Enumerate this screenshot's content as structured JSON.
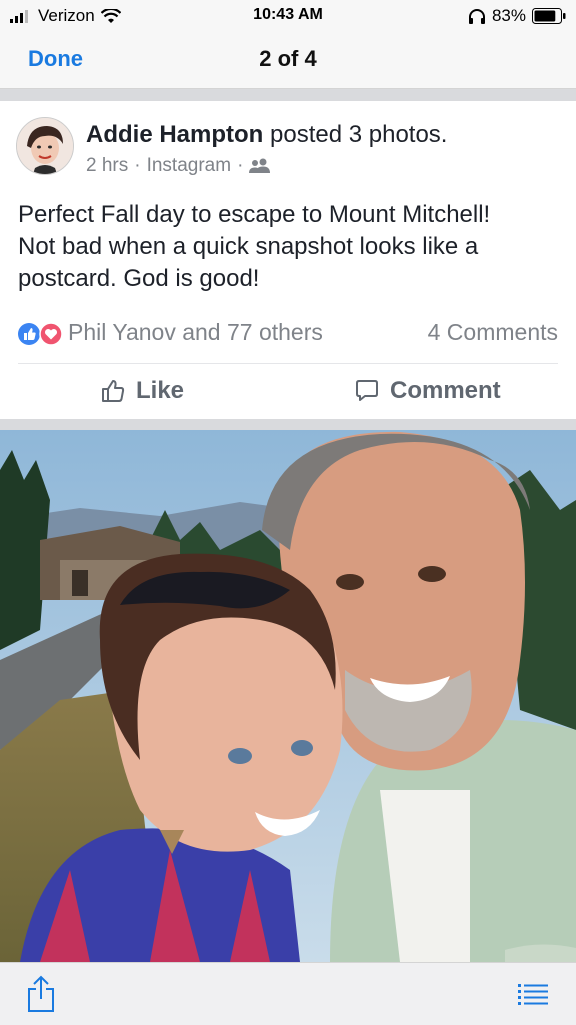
{
  "status_bar": {
    "carrier": "Verizon",
    "time": "10:43 AM",
    "battery": "83%",
    "battery_level": 0.83,
    "icons": [
      "signal-icon",
      "wifi-icon",
      "headphones-icon",
      "battery-icon"
    ]
  },
  "nav": {
    "done_label": "Done",
    "counter": "2 of 4"
  },
  "post": {
    "author": "Addie Hampton",
    "action": "posted 3 photos.",
    "time": "2 hrs",
    "source": "Instagram",
    "separator": "·",
    "audience_icon": "friends-icon",
    "text_lines": [
      "Perfect Fall day to escape to Mount Mitchell!",
      "Not bad when a quick snapshot looks like a",
      "postcard. God is good!"
    ],
    "reactions": {
      "names": "Phil Yanov and 77 others",
      "comments": "4 Comments",
      "icons": [
        "like-icon",
        "love-icon"
      ]
    },
    "actions": {
      "like_label": "Like",
      "comment_label": "Comment"
    }
  },
  "toolbar": {
    "icons": [
      "share-icon",
      "list-icon"
    ]
  },
  "colors": {
    "accent": "#1a7ae0",
    "like_blue": "#3b84f2",
    "love_red": "#f0546f",
    "meta_gray": "#7f8389"
  }
}
